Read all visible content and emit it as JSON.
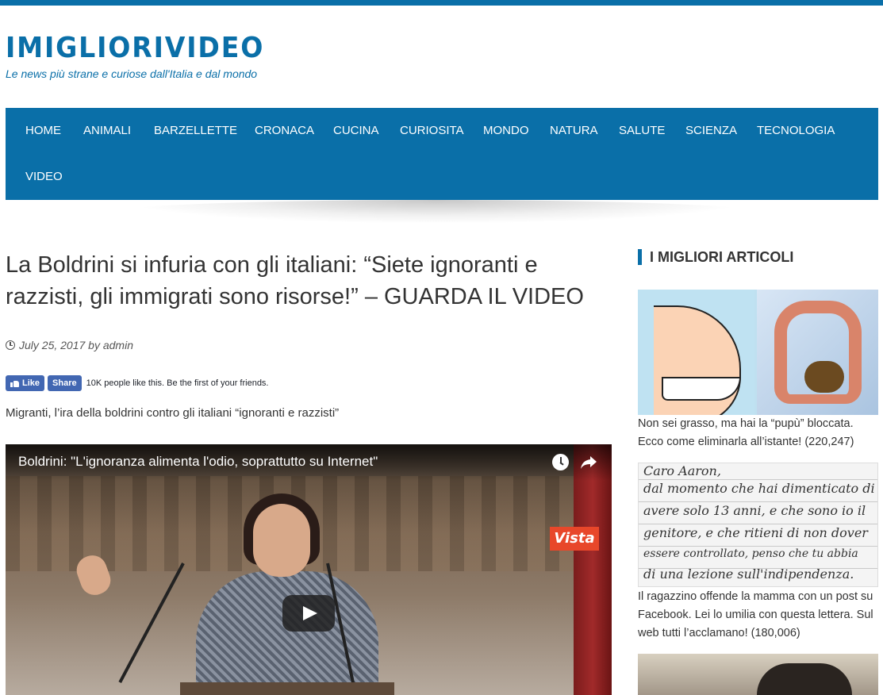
{
  "site": {
    "title": "IMIGLIORIVIDEO",
    "tagline": "Le news più strane e curiose dall'Italia e dal mondo"
  },
  "nav": {
    "items": [
      {
        "label": "HOME"
      },
      {
        "label": "ANIMALI"
      },
      {
        "label": "BARZELLETTE"
      },
      {
        "label": "CRONACA"
      },
      {
        "label": "CUCINA"
      },
      {
        "label": "CURIOSITA"
      },
      {
        "label": "MONDO"
      },
      {
        "label": "NATURA"
      },
      {
        "label": "SALUTE"
      },
      {
        "label": "SCIENZA"
      },
      {
        "label": "TECNOLOGIA"
      },
      {
        "label": "VIDEO"
      }
    ]
  },
  "post": {
    "title": "La Boldrini si infuria con gli italiani: “Siete ignoranti e razzisti, gli immigrati sono risorse!” – GUARDA IL VIDEO",
    "meta": "July 25, 2017 by admin",
    "intro": "Migranti, l’ira della boldrini contro gli italiani “ignoranti e razzisti”"
  },
  "facebook": {
    "like_label": "Like",
    "share_label": "Share",
    "social_text": "10K people like this. Be the first of your friends."
  },
  "video": {
    "title": "Boldrini: \"L'ignoranza alimenta l'odio, soprattutto su Internet\"",
    "logo_text": "Vista",
    "icons": [
      "watch-later-icon",
      "share-icon",
      "play-icon"
    ]
  },
  "sidebar": {
    "heading": "I MIGLIORI ARTICOLI",
    "articles": [
      {
        "caption": "Non sei grasso, ma hai la “pupù” bloccata. Ecco come eliminarla all’istante! (220,247)"
      },
      {
        "caption": "Il ragazzino offende la mamma con un post su Facebook. Lei lo umilia con questa lettera. Sul web tutti l’acclamano! (180,006)"
      }
    ],
    "letter_lines": [
      "Caro Aaron,",
      "dal momento che hai dimenticato di",
      "avere solo 13 anni, e che sono io il",
      "genitore, e che ritieni di non dover",
      "essere controllato, penso che tu abbia",
      "di una lezione sull'indipendenza."
    ]
  },
  "colors": {
    "brand_blue": "#0a6fa8",
    "facebook_blue": "#4267b2",
    "text": "#333333"
  }
}
